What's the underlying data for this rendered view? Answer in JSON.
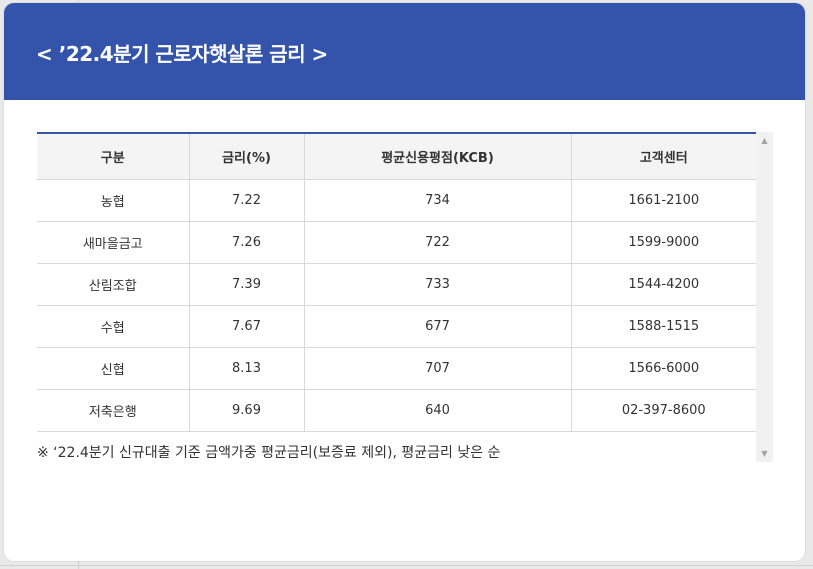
{
  "modal": {
    "title": "< ’22.4분기 근로자햇살론 금리 >"
  },
  "table": {
    "headers": [
      "구분",
      "금리(%)",
      "평균신용평점(KCB)",
      "고객센터"
    ],
    "rows": [
      [
        "농협",
        "7.22",
        "734",
        "1661-2100"
      ],
      [
        "새마을금고",
        "7.26",
        "722",
        "1599-9000"
      ],
      [
        "산림조합",
        "7.39",
        "733",
        "1544-4200"
      ],
      [
        "수협",
        "7.67",
        "677",
        "1588-1515"
      ],
      [
        "신협",
        "8.13",
        "707",
        "1566-6000"
      ],
      [
        "저축은행",
        "9.69",
        "640",
        "02-397-8600"
      ]
    ]
  },
  "footnote": "※ ‘22.4분기 신규대출 기준 금액가중 평균금리(보증료 제외), 평균금리 낮은 순",
  "scrollbar": {
    "up_icon": "▲",
    "down_icon": "▼"
  },
  "colors": {
    "header_bg": "#3454ab",
    "table_top_border": "#3454ab",
    "table_header_bg": "#f4f4f4"
  }
}
